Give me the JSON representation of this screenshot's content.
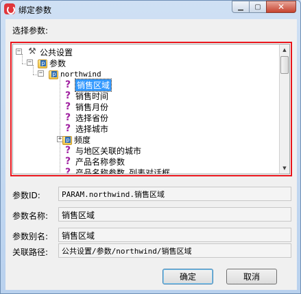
{
  "window": {
    "title": "绑定参数"
  },
  "caption_buttons": {
    "minimize": "▁",
    "maximize": "▢",
    "close": "✕"
  },
  "choose_label": "选择参数:",
  "tree": {
    "root": {
      "label": "公共设置",
      "expanded": true,
      "icon": "tools-icon"
    },
    "params_folder": {
      "label": "参数",
      "expanded": true,
      "icon": "folder-icon"
    },
    "northwind": {
      "label": "northwind",
      "expanded": true,
      "icon": "folder-icon"
    },
    "items": [
      {
        "label": "销售区域",
        "icon": "question-icon",
        "selected": true
      },
      {
        "label": "销售时间",
        "icon": "question-icon"
      },
      {
        "label": "销售月份",
        "icon": "question-icon"
      },
      {
        "label": "选择省份",
        "icon": "question-icon"
      },
      {
        "label": "选择城市",
        "icon": "question-icon"
      },
      {
        "label": "频度",
        "icon": "folder-icon",
        "expanded": false
      },
      {
        "label": "与地区关联的城市",
        "icon": "question-icon"
      },
      {
        "label": "产品名称参数",
        "icon": "question-icon"
      },
      {
        "label": "产品名称参数_列表对话框",
        "icon": "question-icon"
      }
    ]
  },
  "fields": {
    "param_id": {
      "label": "参数ID:",
      "value": "PARAM.northwind.销售区域"
    },
    "param_name": {
      "label": "参数名称:",
      "value": "销售区域"
    },
    "param_alias": {
      "label": "参数别名:",
      "value": "销售区域"
    },
    "assoc_path": {
      "label": "关联路径:",
      "value": "公共设置/参数/northwind/销售区域"
    }
  },
  "buttons": {
    "ok": "确定",
    "cancel": "取消"
  }
}
